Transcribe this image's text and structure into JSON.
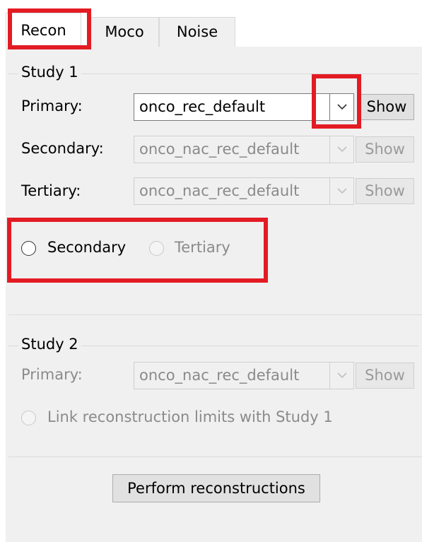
{
  "tabs": [
    {
      "label": "Recon"
    },
    {
      "label": "Moco"
    },
    {
      "label": "Noise"
    }
  ],
  "study1": {
    "title": "Study 1",
    "primary": {
      "label": "Primary:",
      "value": "onco_rec_default",
      "show": "Show"
    },
    "secondary": {
      "label": "Secondary:",
      "value": "onco_nac_rec_default",
      "show": "Show"
    },
    "tertiary": {
      "label": "Tertiary:",
      "value": "onco_nac_rec_default",
      "show": "Show"
    },
    "radio_secondary": "Secondary",
    "radio_tertiary": "Tertiary"
  },
  "study2": {
    "title": "Study 2",
    "primary": {
      "label": "Primary:",
      "value": "onco_nac_rec_default",
      "show": "Show"
    },
    "link_label": "Link reconstruction limits with Study 1"
  },
  "perform_button": "Perform reconstructions",
  "colors": {
    "highlight": "#e31b23",
    "panel": "#f0f0f0"
  },
  "icons": {
    "dropdown": "chevron-down-icon"
  }
}
